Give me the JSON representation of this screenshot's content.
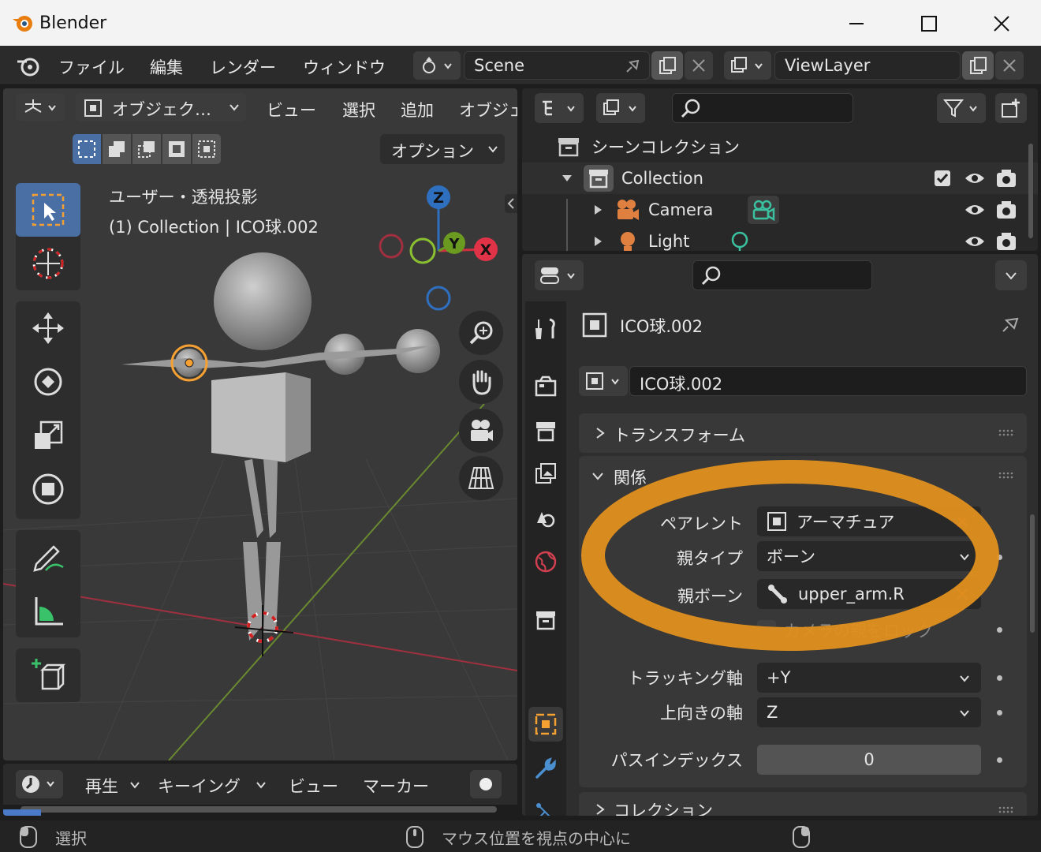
{
  "window": {
    "title": "Blender"
  },
  "menu": {
    "items": [
      "ファイル",
      "編集",
      "レンダー",
      "ウィンドウ"
    ],
    "scene": "Scene",
    "view_layer": "ViewLayer"
  },
  "viewport": {
    "mode": "オブジェク…",
    "header_menu": [
      "ビュー",
      "選択",
      "追加",
      "オブジェ"
    ],
    "options_label": "オプション",
    "overlay_title": "ユーザー・透視投影",
    "overlay_subtitle": "(1) Collection | ICO球.002",
    "gizmo": {
      "z": "Z",
      "y": "Y",
      "x": "X"
    }
  },
  "outliner": {
    "scene_collection": "シーンコレクション",
    "collection": "Collection",
    "items": [
      "Camera",
      "Light"
    ]
  },
  "properties": {
    "object_name": "ICO球.002",
    "object_field": "ICO球.002",
    "panel_transform": "トランスフォーム",
    "panel_relations": "関係",
    "rows": {
      "parent_label": "ペアレント",
      "parent_value": "アーマチュア",
      "parent_type_label": "親タイプ",
      "parent_type_value": "ボーン",
      "parent_bone_label": "親ボーン",
      "parent_bone_value": "upper_arm.R",
      "camera_lock_label": "カメラの親をロック",
      "tracking_label": "トラッキング軸",
      "tracking_value": "+Y",
      "up_label": "上向きの軸",
      "up_value": "Z",
      "pass_label": "パスインデックス",
      "pass_value": "0"
    },
    "panel_collection": "コレクション"
  },
  "timeline": {
    "items": [
      "再生",
      "キーイング",
      "ビュー",
      "マーカー"
    ]
  },
  "status": {
    "left": "選択",
    "center": "マウス位置を視点の中心に"
  },
  "colors": {
    "highlight_ellipse": "#e0901e",
    "selected_orange": "#f5a033",
    "active_tool": "#4a6fa5"
  }
}
